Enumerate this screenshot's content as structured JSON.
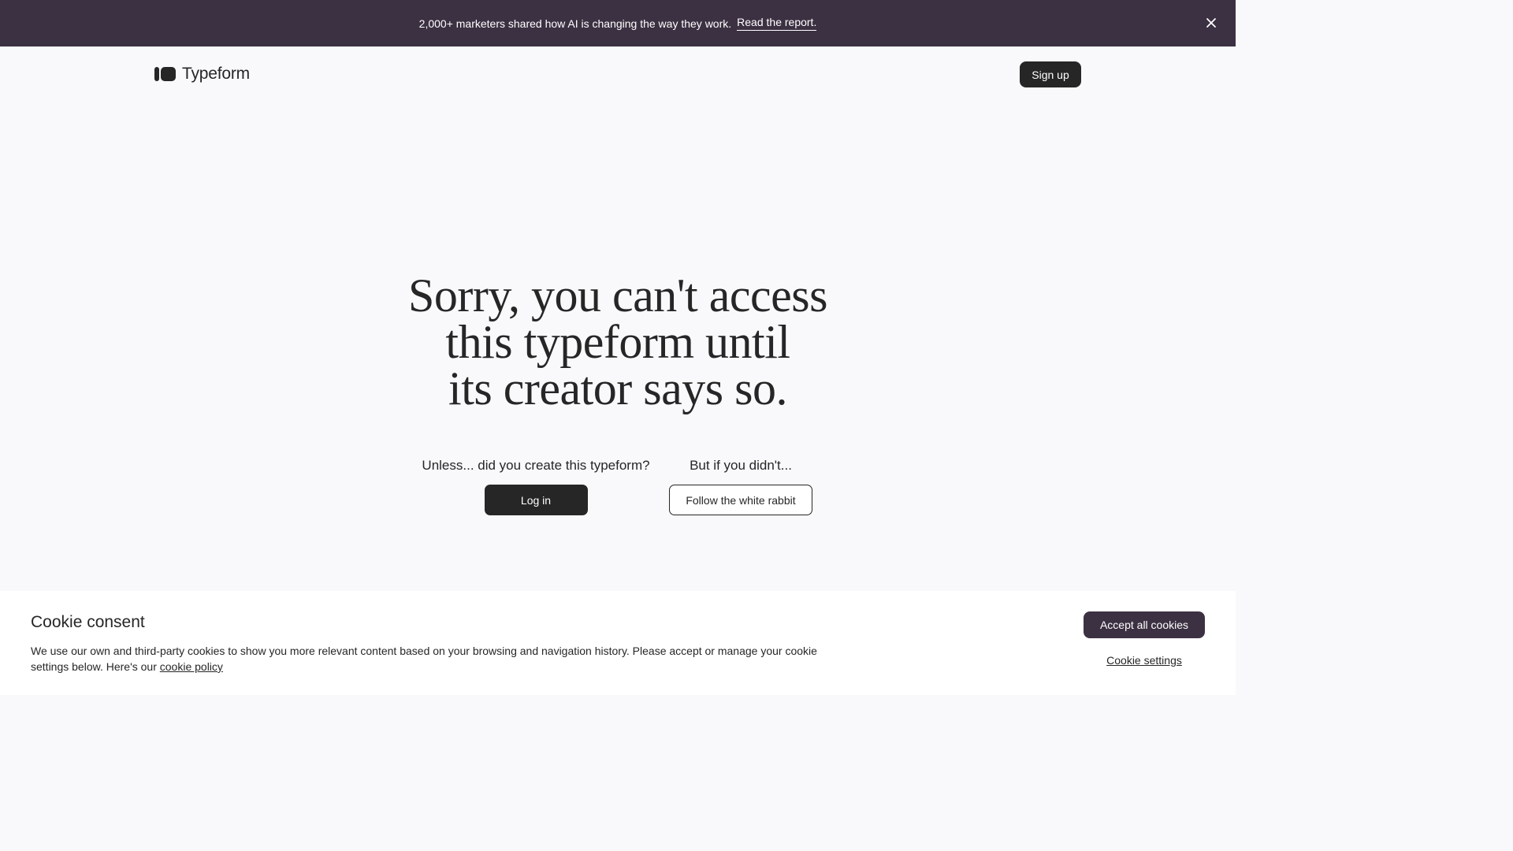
{
  "banner": {
    "message": "2,000+ marketers shared how AI is changing the way they work.",
    "link": "Read the report.",
    "close_icon": "close-icon",
    "background": "#3c3142"
  },
  "header": {
    "logo_text": "Typeform",
    "signup_label": "Sign up"
  },
  "main": {
    "headline_lines": [
      "Sorry, you can't access",
      "this typeform until",
      "its creator says so."
    ],
    "left": {
      "prompt": "Unless... did you create this typeform?",
      "button": "Log in"
    },
    "right": {
      "prompt": "But if you didn't...",
      "button": "Follow the white rabbit"
    }
  },
  "cookie": {
    "title": "Cookie consent",
    "text": "We use our own and third-party cookies to show you more relevant content based on your browsing and navigation history. Please accept or manage your cookie settings below. Here's our",
    "policy_link": "cookie policy",
    "accept_label": "Accept all cookies",
    "settings_label": "Cookie settings"
  },
  "colors": {
    "primary_dark": "#262627",
    "accent_purple": "#3c3142",
    "page_background": "#f9f9fb"
  }
}
